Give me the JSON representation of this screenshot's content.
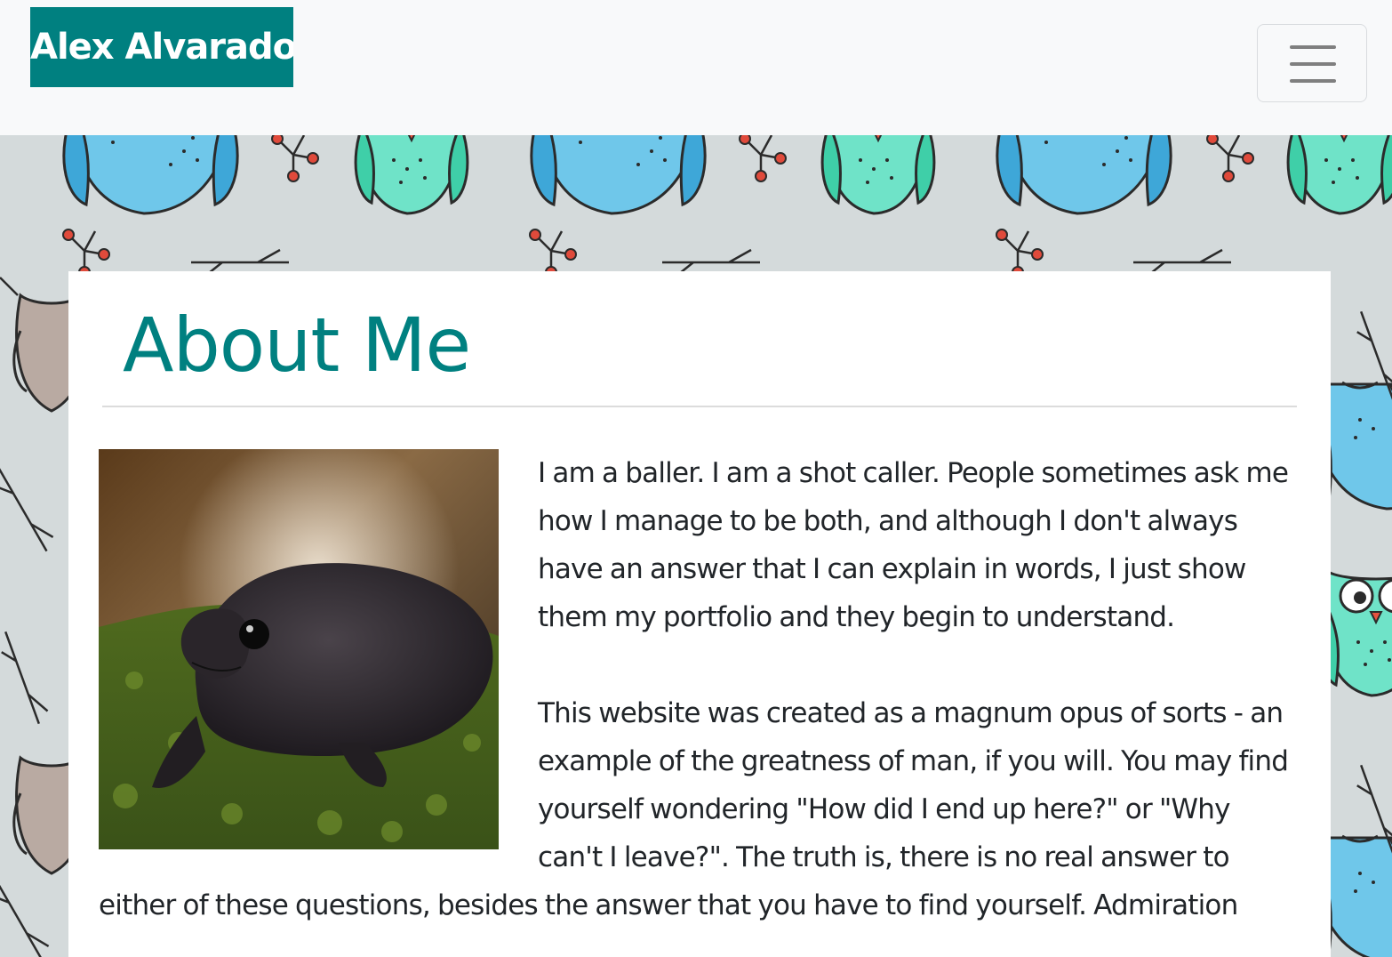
{
  "navbar": {
    "brand": "Alex Alvarado",
    "toggler_icon": "hamburger-icon"
  },
  "colors": {
    "brand": "#008080",
    "navbar_bg": "#f8f9fa",
    "text": "#212529",
    "pattern_bg": "#d4dadb"
  },
  "about": {
    "heading": "About Me",
    "photo_icon": "frog-photo",
    "paragraphs": [
      "I am a baller. I am a shot caller. People sometimes ask me how I manage to be both, and although I don't always have an answer that I can explain in words, I just show them my portfolio and they begin to understand.",
      "This website was created as a magnum opus of sorts - an example of the greatness of man, if you will. You may find yourself wondering \"How did I end up here?\" or \"Why can't I leave?\". The truth is, there is no real answer to either of these questions, besides the answer that you have to find yourself. Admiration"
    ]
  }
}
